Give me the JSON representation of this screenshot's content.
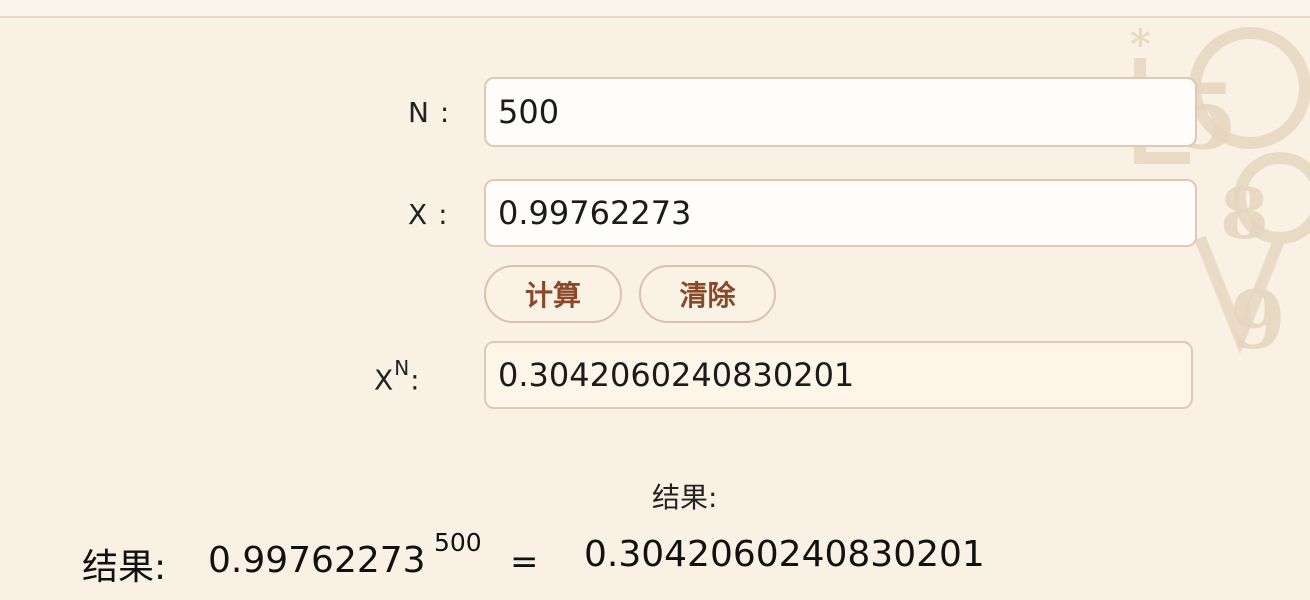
{
  "form": {
    "n_label": "N :",
    "n_value": "500",
    "x_label": "X :",
    "x_value": "0.99762273",
    "power_label_base": "X",
    "power_label_exp": "N",
    "power_label_colon": ":",
    "power_value": "0.3042060240830201"
  },
  "buttons": {
    "calculate": "计算",
    "clear": "清除"
  },
  "result": {
    "heading": "结果:",
    "prefix": "结果:",
    "base": "0.99762273",
    "exponent": "500",
    "equals": "=",
    "value": "0.3042060240830201"
  },
  "colors": {
    "background": "#f9f2e4",
    "field_border": "#e2c8b4",
    "button_text": "#8a4a2a"
  }
}
